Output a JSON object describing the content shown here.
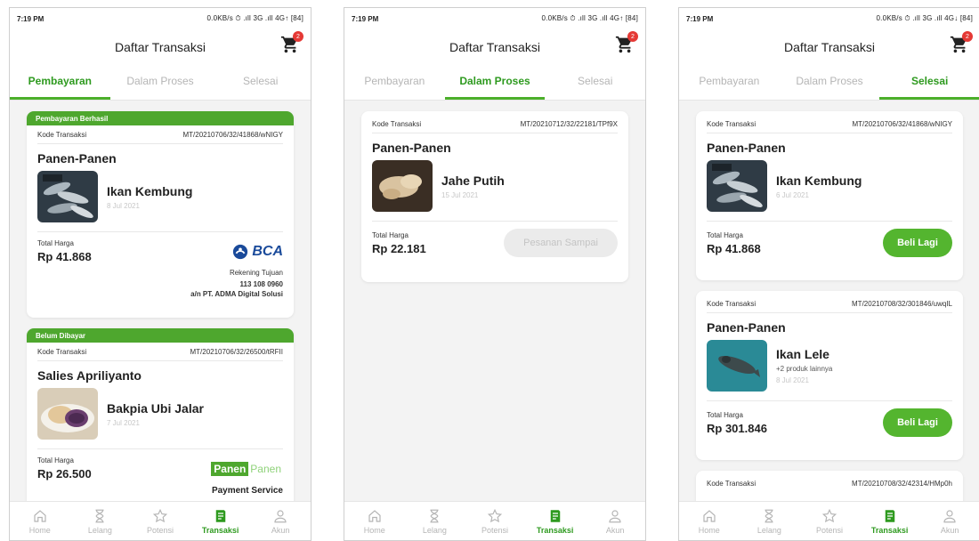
{
  "status_bar": {
    "time": "7:19 PM",
    "indicators": [
      "0.0KB/s ⏱ .ıll 3G .ıll 4G↑ [84]",
      "0.0KB/s ⏱ .ıll 3G .ıll 4G↑ [84]",
      "0.0KB/s ⏱ .ıll 3G .ıll 4G↓ [84]"
    ]
  },
  "header": {
    "title": "Daftar Transaksi",
    "cart_badge": "2"
  },
  "tabs": [
    "Pembayaran",
    "Dalam Proses",
    "Selesai"
  ],
  "labels": {
    "kode": "Kode Transaksi",
    "total": "Total Harga",
    "rekening": "Rekening Tujuan",
    "beli_lagi": "Beli Lagi",
    "pesanan_sampai": "Pesanan Sampai",
    "payment_service": "Payment Service",
    "bca": "BCA",
    "panen_a": "Panen",
    "panen_b": "Panen"
  },
  "screen1": {
    "cards": [
      {
        "banner": "Pembayaran Berhasil",
        "code": "MT/20210706/32/41868/wNIGY",
        "merchant": "Panen-Panen",
        "product": "Ikan Kembung",
        "date": "8 Jul 2021",
        "total": "Rp 41.868",
        "account_number": "113 108 0960",
        "account_owner": "a/n PT. ADMA Digital Solusi"
      },
      {
        "banner": "Belum Dibayar",
        "code": "MT/20210706/32/26500/tRFII",
        "merchant": "Salies Apriliyanto",
        "product": "Bakpia Ubi Jalar",
        "date": "7 Jul 2021",
        "total": "Rp 26.500"
      }
    ]
  },
  "screen2": {
    "cards": [
      {
        "code": "MT/20210712/32/22181/TPf9X",
        "merchant": "Panen-Panen",
        "product": "Jahe Putih",
        "date": "15 Jul 2021",
        "total": "Rp 22.181"
      }
    ]
  },
  "screen3": {
    "cards": [
      {
        "code": "MT/20210706/32/41868/wNIGY",
        "merchant": "Panen-Panen",
        "product": "Ikan Kembung",
        "date": "6 Jul 2021",
        "total": "Rp 41.868"
      },
      {
        "code": "MT/20210708/32/301846/uwqIL",
        "merchant": "Panen-Panen",
        "product": "Ikan Lele",
        "more": "+2 produk lainnya",
        "date": "8 Jul 2021",
        "total": "Rp 301.846"
      },
      {
        "code": "MT/20210708/32/42314/HMp0h"
      }
    ]
  },
  "nav": [
    {
      "label": "Home",
      "icon": "home-icon"
    },
    {
      "label": "Lelang",
      "icon": "hourglass-icon"
    },
    {
      "label": "Potensi",
      "icon": "star-icon"
    },
    {
      "label": "Transaksi",
      "icon": "receipt-icon"
    },
    {
      "label": "Akun",
      "icon": "user-icon"
    }
  ],
  "colors": {
    "accent": "#4ea72e",
    "accent_dark": "#2e9a1f",
    "badge": "#e53935",
    "bca": "#1a4a9a"
  }
}
